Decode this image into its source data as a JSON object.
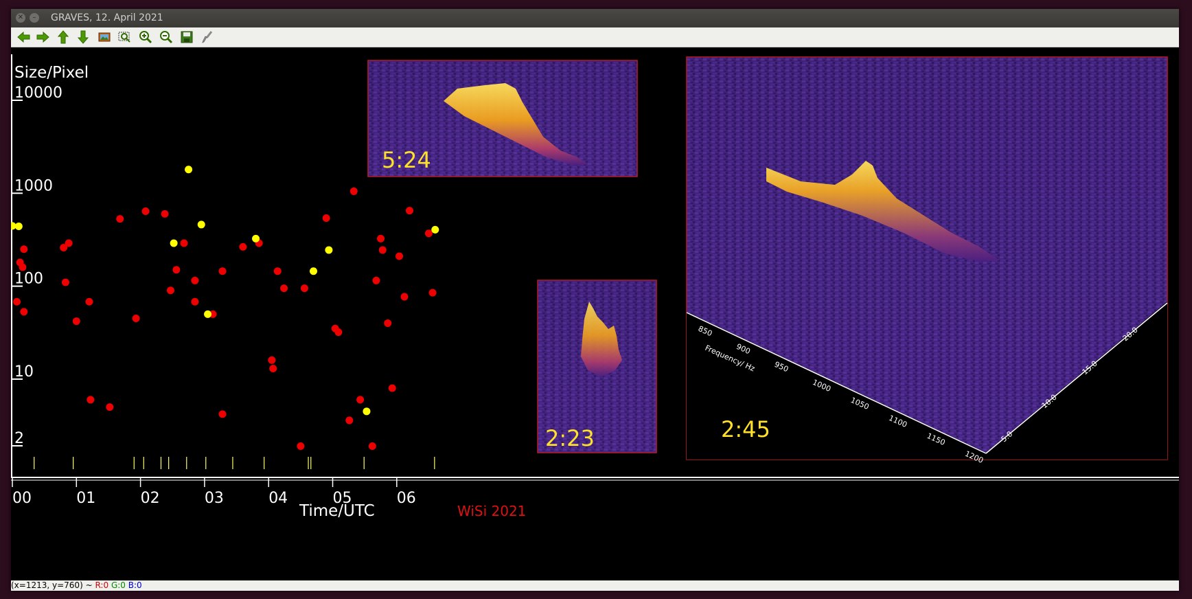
{
  "window": {
    "title": "GRAVES, 12. April 2021",
    "controls": [
      "close-icon",
      "minimize-icon"
    ]
  },
  "toolbar": {
    "tools": [
      "back-arrow-icon",
      "forward-arrow-icon",
      "up-arrow-icon",
      "down-arrow-icon",
      "image-icon",
      "zoom-region-icon",
      "zoom-in-icon",
      "zoom-out-icon",
      "save-icon",
      "brush-icon"
    ]
  },
  "status": {
    "coords": "(x=1213, y=760) ~",
    "r": "R:0",
    "g": "G:0",
    "b": "B:0",
    "colors": {
      "r": "#d40000",
      "g": "#008800",
      "b": "#0000cc"
    }
  },
  "chart_data": {
    "type": "scatter",
    "ylabel": "Size/Pixel",
    "xlabel": "Time/UTC",
    "credit": "WiSi 2021",
    "yscale": "log",
    "ytick_labels": [
      "10000",
      "1000",
      "100",
      "10",
      "2"
    ],
    "yticks": [
      10000,
      1000,
      100,
      10,
      2
    ],
    "xtick_labels": [
      "00",
      "01",
      "02",
      "03",
      "04",
      "05",
      "06"
    ],
    "xticks": [
      0,
      1,
      2,
      3,
      4,
      5,
      6
    ],
    "xlim": [
      0,
      6.93
    ],
    "ylim": [
      1.5,
      20000
    ],
    "colors": {
      "red": "#ee0000",
      "yellow": "#ffff00",
      "axis": "#ffffff",
      "label": "#ffffff",
      "credit": "#dd1111"
    },
    "series": [
      {
        "color": "red",
        "points": [
          [
            0.07,
            68
          ],
          [
            0.18,
            53
          ],
          [
            0.12,
            180
          ],
          [
            0.16,
            160
          ],
          [
            0.18,
            250
          ],
          [
            0.8,
            260
          ],
          [
            0.88,
            290
          ],
          [
            0.83,
            110
          ],
          [
            1.0,
            42
          ],
          [
            1.2,
            68
          ],
          [
            1.22,
            6
          ],
          [
            1.52,
            5
          ],
          [
            1.68,
            530
          ],
          [
            1.93,
            45
          ],
          [
            2.08,
            640
          ],
          [
            2.38,
            600
          ],
          [
            2.47,
            90
          ],
          [
            2.56,
            150
          ],
          [
            2.68,
            290
          ],
          [
            2.85,
            115
          ],
          [
            2.85,
            68
          ],
          [
            3.13,
            50
          ],
          [
            3.28,
            145
          ],
          [
            3.28,
            4.2
          ],
          [
            3.6,
            265
          ],
          [
            3.85,
            290
          ],
          [
            4.05,
            16
          ],
          [
            4.07,
            13
          ],
          [
            4.14,
            145
          ],
          [
            4.24,
            95
          ],
          [
            4.5,
            1.9
          ],
          [
            4.56,
            95
          ],
          [
            4.9,
            540
          ],
          [
            5.04,
            35
          ],
          [
            5.09,
            32
          ],
          [
            5.26,
            3.6
          ],
          [
            5.33,
            1050
          ],
          [
            5.43,
            6
          ],
          [
            5.62,
            1.9
          ],
          [
            5.68,
            115
          ],
          [
            5.75,
            325
          ],
          [
            5.78,
            245
          ],
          [
            5.86,
            40
          ],
          [
            5.93,
            8
          ],
          [
            6.04,
            210
          ],
          [
            6.12,
            77
          ],
          [
            6.2,
            650
          ],
          [
            6.5,
            370
          ],
          [
            6.56,
            85
          ]
        ]
      },
      {
        "color": "yellow",
        "points": [
          [
            0.0,
            445
          ],
          [
            0.1,
            440
          ],
          [
            2.75,
            1800
          ],
          [
            2.52,
            290
          ],
          [
            2.95,
            460
          ],
          [
            3.05,
            50
          ],
          [
            3.8,
            325
          ],
          [
            4.7,
            145
          ],
          [
            4.94,
            245
          ],
          [
            5.53,
            4.5
          ],
          [
            6.6,
            405
          ]
        ]
      }
    ],
    "event_ticks": [
      0.34,
      0.95,
      1.9,
      2.05,
      2.32,
      2.44,
      2.72,
      3.02,
      3.44,
      3.93,
      4.62,
      4.66,
      5.49,
      6.59
    ],
    "insets": [
      {
        "label": "5:24",
        "label_color": "#ffe12a"
      },
      {
        "label": "2:23",
        "label_color": "#ffe12a"
      },
      {
        "label": "2:45",
        "label_color": "#ffe12a",
        "axis_title": "Frequency/ Hz",
        "freq_ticks": [
          "850",
          "900",
          "950",
          "1000",
          "1050",
          "1100",
          "1150",
          "1200"
        ],
        "time_ticks": [
          "5.0",
          "10.0",
          "15.0",
          "20.0"
        ]
      }
    ]
  }
}
